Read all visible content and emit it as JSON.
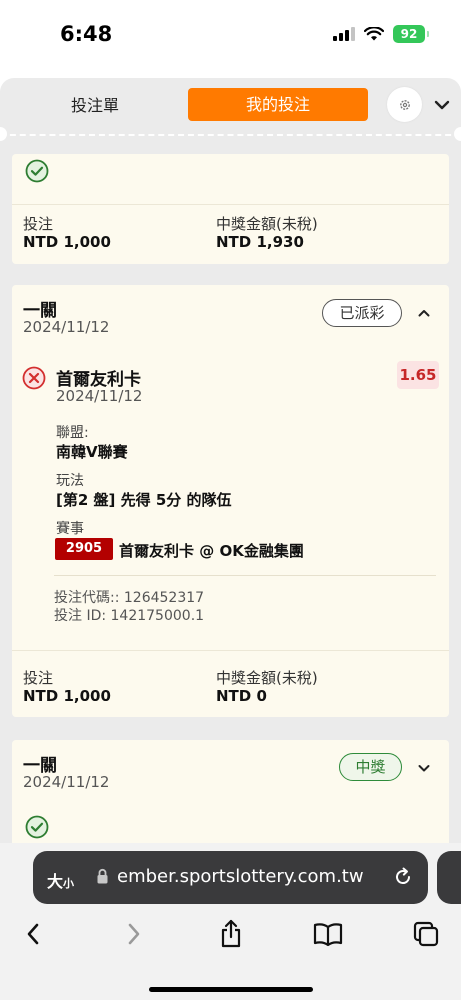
{
  "status_bar": {
    "time": "6:48",
    "battery": "92"
  },
  "tabs": {
    "betslip": "投注單",
    "my_bets": "我的投注"
  },
  "cards": [
    {
      "footer": {
        "stake_label": "投注",
        "stake_value": "NTD 1,000",
        "payout_label": "中獎金額(未稅)",
        "payout_value": "NTD 1,930"
      }
    },
    {
      "title": "一關",
      "date": "2024/11/12",
      "status": "已派彩",
      "selection": {
        "team": "首爾友利卡",
        "date": "2024/11/12",
        "odds": "1.65",
        "league_label": "聯盟:",
        "league_value": "南韓V聯賽",
        "market_label": "玩法",
        "market_value": "[第2 盤] 先得 5分 的隊伍",
        "event_label": "賽事",
        "event_no": "2905",
        "event_name": "首爾友利卡 @ OK金融集團",
        "bet_code": "投注代碼:: 126452317",
        "bet_id": "投注 ID: 142175000.1"
      },
      "footer": {
        "stake_label": "投注",
        "stake_value": "NTD 1,000",
        "payout_label": "中獎金額(未稅)",
        "payout_value": "NTD 0"
      }
    },
    {
      "title": "一關",
      "date": "2024/11/12",
      "status": "中獎"
    }
  ],
  "browser": {
    "aa_big": "大",
    "aa_small": "小",
    "url": "ember.sportslottery.com.tw"
  },
  "colors": {
    "accent": "#ff7a00",
    "card": "#fdfaee",
    "lost": "#d32f2f",
    "won": "#2e7d32"
  }
}
